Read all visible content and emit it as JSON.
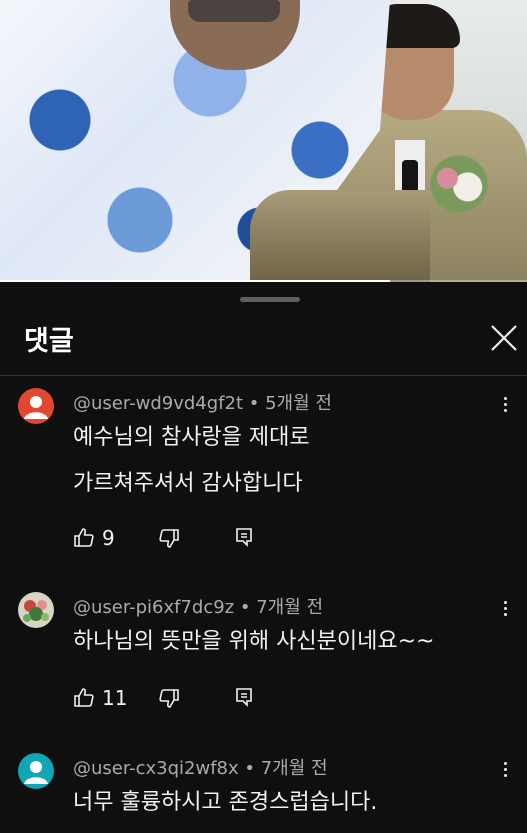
{
  "sheet": {
    "title": "댓글"
  },
  "video": {
    "progress": 0.74
  },
  "comments": [
    {
      "user": "@user-wd9vd4gf2t",
      "time": "5개월 전",
      "lines": [
        "예수님의 참사랑을 제대로",
        "가르쳐주셔서 감사합니다"
      ],
      "likes": "9",
      "avatar_color": "#e2472f"
    },
    {
      "user": "@user-pi6xf7dc9z",
      "time": "7개월 전",
      "lines": [
        "하나님의 뜻만을 위해 사신분이네요~~"
      ],
      "likes": "11",
      "avatar_color": "#d6d1c2"
    },
    {
      "user": "@user-cx3qi2wf8x",
      "time": "7개월 전",
      "lines": [
        "너무 훌륭하시고 존경스럽습니다."
      ],
      "likes": "",
      "avatar_color": "#12a6b5"
    }
  ],
  "separator": " • ",
  "icons": {
    "like": "thumbs-up-icon",
    "dislike": "thumbs-down-icon",
    "reply": "reply-icon",
    "more": "more-vert-icon",
    "close": "close-icon"
  }
}
